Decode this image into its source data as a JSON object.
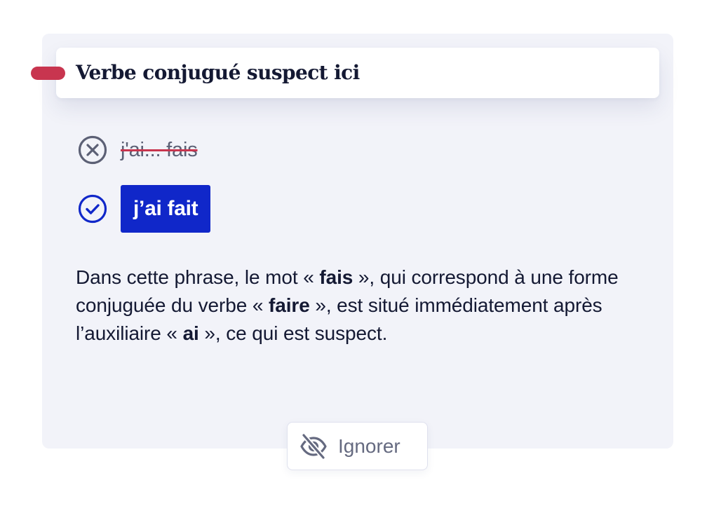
{
  "card": {
    "title": "Verbe conjugué suspect ici"
  },
  "wrong": {
    "text": "j'ai... fais",
    "icon": "x-circle-icon"
  },
  "suggestion": {
    "text": "j’ai fait",
    "icon": "check-circle-icon"
  },
  "explanation": {
    "t1": "Dans cette phrase, le mot « ",
    "b1": "fais",
    "t2": " », qui correspond à une forme conjuguée du verbe « ",
    "b2": "faire",
    "t3": " », est situé immédiatement après l’auxiliaire « ",
    "b3": "ai",
    "t4": " », ce qui est suspect."
  },
  "ignore": {
    "label": "Ignorer",
    "icon": "eye-off-icon"
  },
  "colors": {
    "accent_red": "#c8354f",
    "primary_blue": "#1027c9",
    "card_background": "#f2f3f9",
    "text_dark": "#141933",
    "text_muted": "#5c6075"
  }
}
